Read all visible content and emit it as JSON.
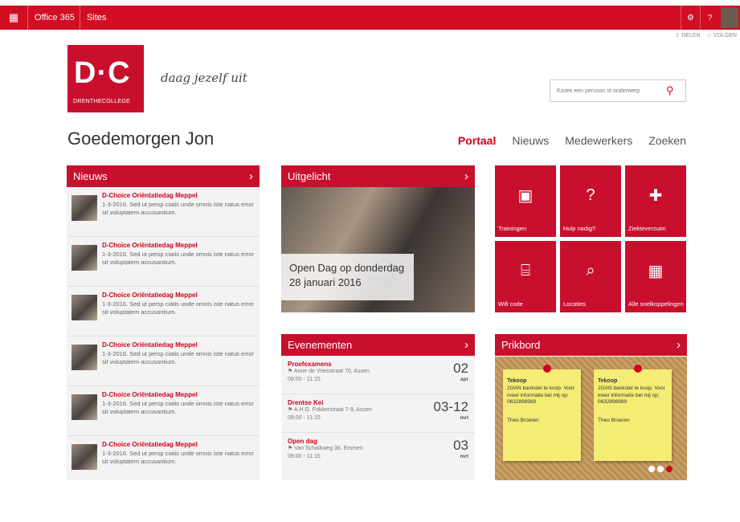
{
  "suitebar": {
    "app": "Office 365",
    "section": "Sites",
    "settings_icon": "gear-icon",
    "help_label": "?"
  },
  "subactions": {
    "share": "DELEN",
    "follow": "VOLGEN"
  },
  "header": {
    "logo_big": "D·C",
    "logo_small": "DRENTHECOLLEGE",
    "tagline": "daag jezelf uit",
    "search_placeholder": "Kzoek een persoon of onderwerp"
  },
  "greeting": "Goedemorgen Jon",
  "nav": [
    "Portaal",
    "Nieuws",
    "Medewerkers",
    "Zoeken"
  ],
  "nieuws": {
    "title": "Nieuws",
    "items": [
      {
        "title": "D-Choice Oriëntatiedag Meppel",
        "text": "1-3-2016. Sed ut persp ciatis unde omnis iste natus error sit voluptatem accusantium."
      },
      {
        "title": "D-Choice Oriëntatiedag Meppel",
        "text": "1-3-2016. Sed ut persp ciatis unde omnis iste natus error sit voluptatem accusantium."
      },
      {
        "title": "D-Choice Oriëntatiedag Meppel",
        "text": "1-3-2016. Sed ut persp ciatis unde omnis iste natus error sit voluptatem accusantium."
      },
      {
        "title": "D-Choice Oriëntatiedag Meppel",
        "text": "1-3-2016. Sed ut persp ciatis unde omnis iste natus error sit voluptatem accusantium."
      },
      {
        "title": "D-Choice Oriëntatiedag Meppel",
        "text": "1-3-2016. Sed ut persp ciatis unde omnis iste natus error sit voluptatem accusantium."
      },
      {
        "title": "D-Choice Oriëntatiedag Meppel",
        "text": "1-3-2016. Sed ut persp ciatis unde omnis iste natus error sit voluptatem accusantium."
      }
    ]
  },
  "uitgelicht": {
    "title": "Uitgelicht",
    "caption_line1": "Open Dag op donderdag",
    "caption_line2": "28 januari 2016"
  },
  "tiles": [
    {
      "label": "Trainingen",
      "icon": "certificate-icon"
    },
    {
      "label": "Hulp nodig?",
      "icon": "question-icon"
    },
    {
      "label": "Ziekteverzuim",
      "icon": "medical-document-icon"
    },
    {
      "label": "Wifi code",
      "icon": "router-icon"
    },
    {
      "label": "Locaties",
      "icon": "map-search-icon"
    },
    {
      "label": "Alle snelkoppelingen",
      "icon": "calendar-grid-icon"
    }
  ],
  "evenementen": {
    "title": "Evenementen",
    "items": [
      {
        "title": "Proefexamens",
        "location": "Anne de Vriesstraat 70, Assen",
        "time": "09:00 - 11:15",
        "day": "02",
        "month": "apr"
      },
      {
        "title": "Drentse Kei",
        "location": "A.H.G. Fokkerstraat 7-9, Assen",
        "time": "09:00 - 11:15",
        "day": "03-12",
        "month": "mrt"
      },
      {
        "title": "Open dag",
        "location": "Van Schaikweg 38, Emmen",
        "time": "09:00 - 11:15",
        "day": "03",
        "month": "mrt"
      }
    ]
  },
  "prikbord": {
    "title": "Prikbord",
    "notes": [
      {
        "heading": "Tekoop",
        "text": "2GAN bankstel te koop. Voor meer informatie bel mij op: 0632898989",
        "author": "Theo Broeren"
      },
      {
        "heading": "Tekoop",
        "text": "2GAN bankstel te koop. Voor meer informatie bel mij op: 0632898989",
        "author": "Theo Broeren"
      }
    ]
  },
  "colors": {
    "brand": "#c8102e",
    "accent": "#d0021b"
  }
}
